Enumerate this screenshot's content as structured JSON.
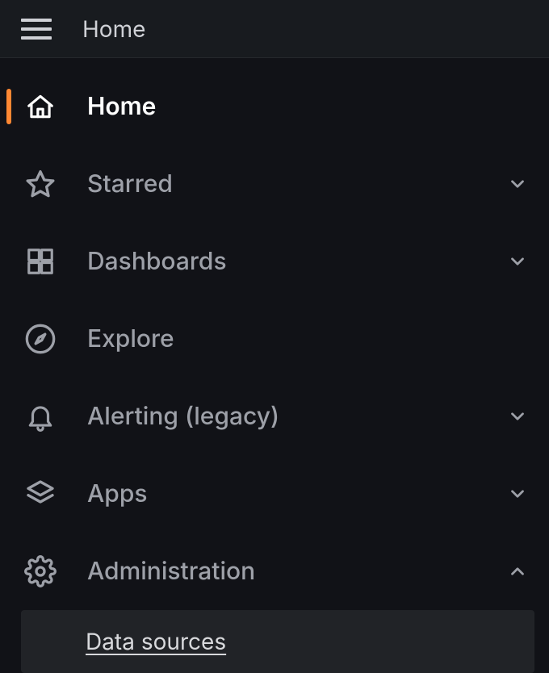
{
  "topbar": {
    "title": "Home"
  },
  "sidebar": {
    "items": [
      {
        "id": "home",
        "label": "Home",
        "icon": "home-icon",
        "active": true,
        "expandable": false
      },
      {
        "id": "starred",
        "label": "Starred",
        "icon": "star-icon",
        "active": false,
        "expandable": true,
        "expanded": false
      },
      {
        "id": "dashboards",
        "label": "Dashboards",
        "icon": "grid-icon",
        "active": false,
        "expandable": true,
        "expanded": false
      },
      {
        "id": "explore",
        "label": "Explore",
        "icon": "compass-icon",
        "active": false,
        "expandable": false
      },
      {
        "id": "alerting",
        "label": "Alerting (legacy)",
        "icon": "bell-icon",
        "active": false,
        "expandable": true,
        "expanded": false
      },
      {
        "id": "apps",
        "label": "Apps",
        "icon": "layers-icon",
        "active": false,
        "expandable": true,
        "expanded": false
      },
      {
        "id": "admin",
        "label": "Administration",
        "icon": "gear-icon",
        "active": false,
        "expandable": true,
        "expanded": true,
        "children": [
          {
            "id": "datasources",
            "label": "Data sources"
          }
        ]
      }
    ]
  },
  "colors": {
    "accent": "#ff8833",
    "bg": "#111217",
    "fg_muted": "#9da0a8",
    "fg": "#ffffff"
  }
}
